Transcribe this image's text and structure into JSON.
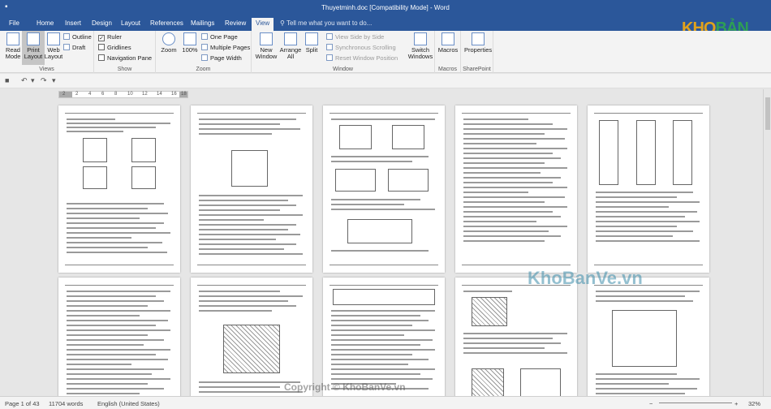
{
  "window": {
    "title": "Thuyetminh.doc  [Compatibility Mode]  -  Word"
  },
  "tabs": [
    "File",
    "Home",
    "Insert",
    "Design",
    "Layout",
    "References",
    "Mailings",
    "Review",
    "View"
  ],
  "tell_me": "Tell me what you want to do...",
  "logo": {
    "part1": "KHO",
    "part2": "BẢN VẼ"
  },
  "ribbon": {
    "views": {
      "label": "Views",
      "read_mode": "Read Mode",
      "print_layout": "Print Layout",
      "web_layout": "Web Layout",
      "outline": "Outline",
      "draft": "Draft"
    },
    "show": {
      "label": "Show",
      "ruler": "Ruler",
      "gridlines": "Gridlines",
      "nav_pane": "Navigation Pane",
      "ruler_checked": "✓"
    },
    "zoom": {
      "label": "Zoom",
      "zoom": "Zoom",
      "hundred": "100%",
      "one_page": "One Page",
      "multiple_pages": "Multiple Pages",
      "page_width": "Page Width"
    },
    "window": {
      "label": "Window",
      "new_window": "New Window",
      "arrange_all": "Arrange All",
      "split": "Split",
      "side_by_side": "View Side by Side",
      "sync_scroll": "Synchronous Scrolling",
      "reset_pos": "Reset Window Position",
      "switch_windows": "Switch Windows"
    },
    "macros": {
      "label": "Macros",
      "macros": "Macros"
    },
    "sharepoint": {
      "label": "SharePoint",
      "properties": "Properties"
    }
  },
  "ruler": {
    "numbers": [
      "2",
      "2",
      "4",
      "6",
      "8",
      "10",
      "12",
      "14",
      "16",
      "18"
    ]
  },
  "watermarks": {
    "main": "KhoBanVe.vn",
    "copyright": "Copyright © KhoBanVe.vn"
  },
  "status": {
    "page": "Page 1 of 43",
    "words": "11704 words",
    "language": "English (United States)",
    "zoom": "32%"
  },
  "colors": {
    "word_blue": "#2b579a",
    "logo_orange": "#e2a21b",
    "logo_green": "#2e9e55"
  }
}
